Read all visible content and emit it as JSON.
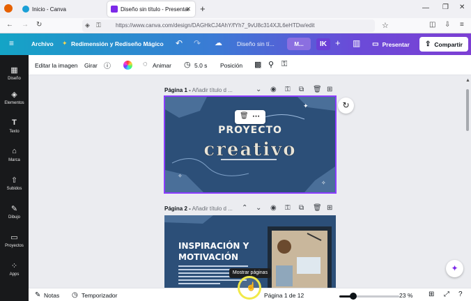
{
  "browser": {
    "tabs": [
      {
        "label": "Inicio - Canva",
        "active": false
      },
      {
        "label": "Diseño sin título - Presentación",
        "active": true
      }
    ],
    "new_tab_symbol": "+",
    "url": "https://www.canva.com/design/DAGHkCJ4AhY/fYh7_9vU8c314XJL6eHTDw/edit"
  },
  "header": {
    "file_label": "Archivo",
    "magic_label": "Redimensión y Rediseño Mágico",
    "design_title": "Diseño sin tí...",
    "m_label": "M...",
    "ik_label": "IK",
    "present_label": "Presentar",
    "share_label": "Compartir"
  },
  "sidebar": {
    "items": [
      {
        "label": "Diseño",
        "icon": "layout-icon"
      },
      {
        "label": "Elementos",
        "icon": "shapes-icon"
      },
      {
        "label": "Texto",
        "icon": "text-icon"
      },
      {
        "label": "Marca",
        "icon": "brand-icon"
      },
      {
        "label": "Subidos",
        "icon": "upload-icon"
      },
      {
        "label": "Dibujo",
        "icon": "draw-icon"
      },
      {
        "label": "Proyectos",
        "icon": "folder-icon"
      },
      {
        "label": "Apps",
        "icon": "apps-icon"
      }
    ]
  },
  "toolbar": {
    "edit_image": "Editar la imagen",
    "rotate": "Girar",
    "animate": "Animar",
    "duration": "5.0 s",
    "position": "Posición"
  },
  "pages": [
    {
      "label": "Página 1 -",
      "title_placeholder": "Añadir título d ...",
      "line1": "PROYECTO",
      "line2": "creativo"
    },
    {
      "label": "Página 2 -",
      "title_placeholder": "Añadir título d ...",
      "heading1": "INSPIRACIÓN Y",
      "heading2": "MOTIVACIÓN"
    }
  ],
  "bottom": {
    "notes": "Notas",
    "timer": "Temporizador",
    "page_indicator": "Página 1 de 12",
    "zoom": "23 %",
    "zoom_fraction": 0.23,
    "tooltip": "Mostrar páginas"
  },
  "colors": {
    "canva_purple": "#8b3dff",
    "slide_blue": "#2c4f78",
    "sidebar_bg": "#18191b"
  }
}
